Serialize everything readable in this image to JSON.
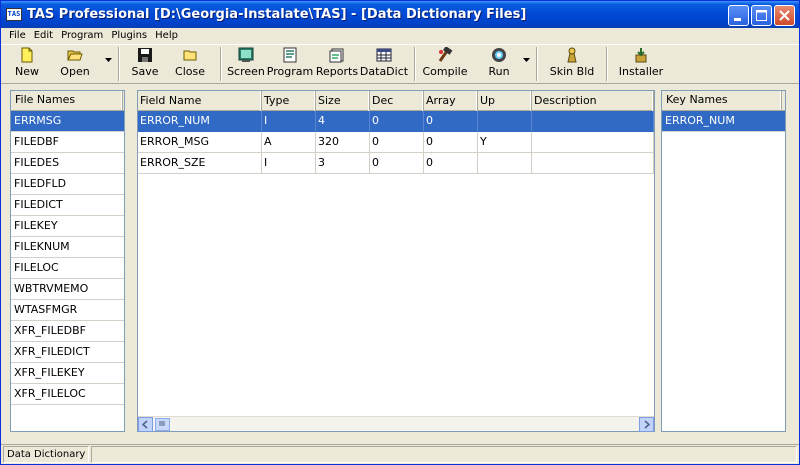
{
  "window": {
    "title": "TAS Professional [D:\\Georgia-Instalate\\TAS] - [Data Dictionary Files]",
    "app_icon_text": "TAS"
  },
  "menu": [
    "File",
    "Edit",
    "Program",
    "Plugins",
    "Help"
  ],
  "toolbar": [
    {
      "label": "New",
      "icon": "new-file-icon"
    },
    {
      "label": "Open",
      "icon": "open-folder-icon",
      "dropdown": true
    },
    {
      "label": "Save",
      "icon": "save-disk-icon"
    },
    {
      "label": "Close",
      "icon": "close-folder-icon"
    },
    {
      "label": "Screen",
      "icon": "screen-icon"
    },
    {
      "label": "Program",
      "icon": "program-icon"
    },
    {
      "label": "Reports",
      "icon": "reports-icon"
    },
    {
      "label": "DataDict",
      "icon": "datadict-icon"
    },
    {
      "label": "Compile",
      "icon": "compile-icon"
    },
    {
      "label": "Run",
      "icon": "run-icon",
      "dropdown": true
    },
    {
      "label": "Skin Bld",
      "icon": "skin-build-icon"
    },
    {
      "label": "Installer",
      "icon": "installer-icon"
    }
  ],
  "file_list": {
    "header": "File Names",
    "selected_index": 0,
    "items": [
      "ERRMSG",
      "FILEDBF",
      "FILEDES",
      "FILEDFLD",
      "FILEDICT",
      "FILEKEY",
      "FILEKNUM",
      "FILELOC",
      "WBTRVMEMO",
      "WTASFMGR",
      "XFR_FILEDBF",
      "XFR_FILEDICT",
      "XFR_FILEKEY",
      "XFR_FILELOC"
    ]
  },
  "field_grid": {
    "columns": [
      "Field Name",
      "Type",
      "Size",
      "Dec",
      "Array",
      "Up",
      "Description"
    ],
    "selected_index": 0,
    "rows": [
      [
        "ERROR_NUM",
        "I",
        "4",
        "0",
        "0",
        "",
        ""
      ],
      [
        "ERROR_MSG",
        "A",
        "320",
        "0",
        "0",
        "Y",
        ""
      ],
      [
        "ERROR_SZE",
        "I",
        "3",
        "0",
        "0",
        "",
        ""
      ]
    ]
  },
  "key_list": {
    "header": "Key Names",
    "selected_index": 0,
    "items": [
      "ERROR_NUM"
    ]
  },
  "status": {
    "text": "Data Dictionary"
  },
  "colors": {
    "title_bar": "#0049d6",
    "selection": "#316ac5",
    "face": "#ece9d8"
  }
}
